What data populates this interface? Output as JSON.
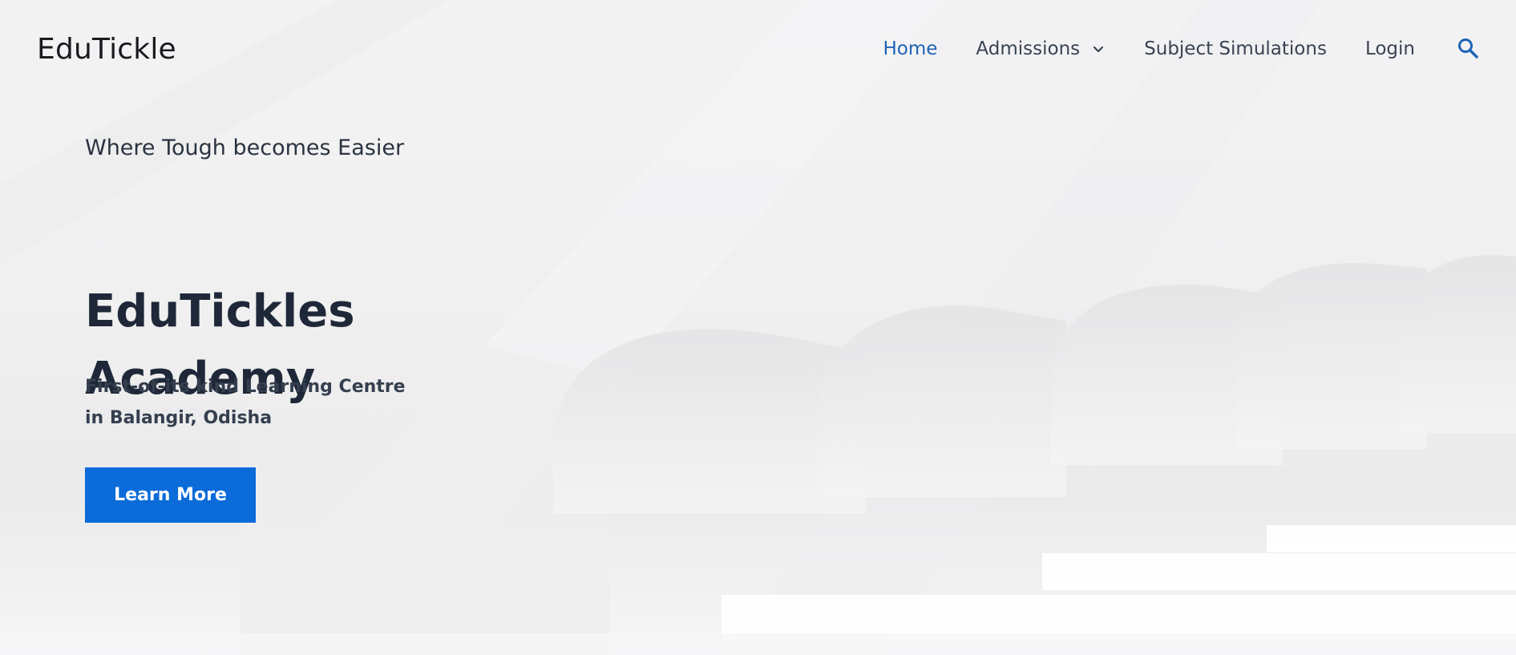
{
  "brand": {
    "logo_text": "EduTickle"
  },
  "nav": {
    "items": [
      {
        "label": "Home",
        "active": true
      },
      {
        "label": "Admissions",
        "has_dropdown": true
      },
      {
        "label": "Subject Simulations"
      },
      {
        "label": "Login"
      }
    ],
    "search_icon": "search-icon"
  },
  "hero": {
    "tagline": "Where Tough becomes Easier",
    "title_line1": "EduTickles",
    "title_line2": "Academy",
    "subtitle_line1": "First-of-its kind Learning Centre",
    "subtitle_line2": "in Balangir, Odisha",
    "cta_label": "Learn More"
  },
  "colors": {
    "accent": "#0a6bd9",
    "nav_active": "#1e63b5",
    "heading": "#1e2838"
  }
}
